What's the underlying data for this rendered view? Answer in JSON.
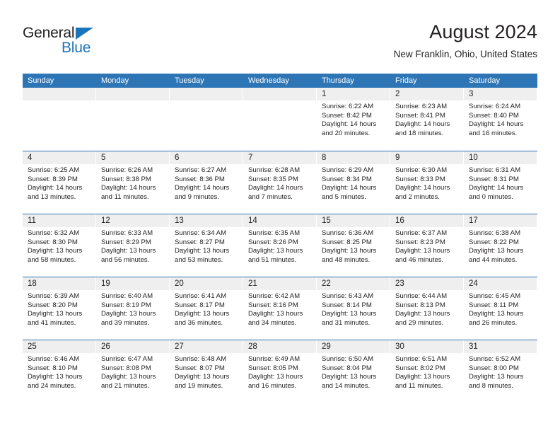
{
  "brand": {
    "name_part1": "General",
    "name_part2": "Blue",
    "accent_color": "#1b75bb",
    "triangle_icon": "blue-triangle-icon"
  },
  "header": {
    "title": "August 2024",
    "subtitle": "New Franklin, Ohio, United States"
  },
  "calendar": {
    "header_bg": "#2e75b6",
    "daynum_bg": "#efefef",
    "weekdays": [
      "Sunday",
      "Monday",
      "Tuesday",
      "Wednesday",
      "Thursday",
      "Friday",
      "Saturday"
    ],
    "weeks": [
      [
        {
          "empty": true
        },
        {
          "empty": true
        },
        {
          "empty": true
        },
        {
          "empty": true
        },
        {
          "day": "1",
          "sunrise": "Sunrise: 6:22 AM",
          "sunset": "Sunset: 8:42 PM",
          "daylight1": "Daylight: 14 hours",
          "daylight2": "and 20 minutes."
        },
        {
          "day": "2",
          "sunrise": "Sunrise: 6:23 AM",
          "sunset": "Sunset: 8:41 PM",
          "daylight1": "Daylight: 14 hours",
          "daylight2": "and 18 minutes."
        },
        {
          "day": "3",
          "sunrise": "Sunrise: 6:24 AM",
          "sunset": "Sunset: 8:40 PM",
          "daylight1": "Daylight: 14 hours",
          "daylight2": "and 16 minutes."
        }
      ],
      [
        {
          "day": "4",
          "sunrise": "Sunrise: 6:25 AM",
          "sunset": "Sunset: 8:39 PM",
          "daylight1": "Daylight: 14 hours",
          "daylight2": "and 13 minutes."
        },
        {
          "day": "5",
          "sunrise": "Sunrise: 6:26 AM",
          "sunset": "Sunset: 8:38 PM",
          "daylight1": "Daylight: 14 hours",
          "daylight2": "and 11 minutes."
        },
        {
          "day": "6",
          "sunrise": "Sunrise: 6:27 AM",
          "sunset": "Sunset: 8:36 PM",
          "daylight1": "Daylight: 14 hours",
          "daylight2": "and 9 minutes."
        },
        {
          "day": "7",
          "sunrise": "Sunrise: 6:28 AM",
          "sunset": "Sunset: 8:35 PM",
          "daylight1": "Daylight: 14 hours",
          "daylight2": "and 7 minutes."
        },
        {
          "day": "8",
          "sunrise": "Sunrise: 6:29 AM",
          "sunset": "Sunset: 8:34 PM",
          "daylight1": "Daylight: 14 hours",
          "daylight2": "and 5 minutes."
        },
        {
          "day": "9",
          "sunrise": "Sunrise: 6:30 AM",
          "sunset": "Sunset: 8:33 PM",
          "daylight1": "Daylight: 14 hours",
          "daylight2": "and 2 minutes."
        },
        {
          "day": "10",
          "sunrise": "Sunrise: 6:31 AM",
          "sunset": "Sunset: 8:31 PM",
          "daylight1": "Daylight: 14 hours",
          "daylight2": "and 0 minutes."
        }
      ],
      [
        {
          "day": "11",
          "sunrise": "Sunrise: 6:32 AM",
          "sunset": "Sunset: 8:30 PM",
          "daylight1": "Daylight: 13 hours",
          "daylight2": "and 58 minutes."
        },
        {
          "day": "12",
          "sunrise": "Sunrise: 6:33 AM",
          "sunset": "Sunset: 8:29 PM",
          "daylight1": "Daylight: 13 hours",
          "daylight2": "and 56 minutes."
        },
        {
          "day": "13",
          "sunrise": "Sunrise: 6:34 AM",
          "sunset": "Sunset: 8:27 PM",
          "daylight1": "Daylight: 13 hours",
          "daylight2": "and 53 minutes."
        },
        {
          "day": "14",
          "sunrise": "Sunrise: 6:35 AM",
          "sunset": "Sunset: 8:26 PM",
          "daylight1": "Daylight: 13 hours",
          "daylight2": "and 51 minutes."
        },
        {
          "day": "15",
          "sunrise": "Sunrise: 6:36 AM",
          "sunset": "Sunset: 8:25 PM",
          "daylight1": "Daylight: 13 hours",
          "daylight2": "and 48 minutes."
        },
        {
          "day": "16",
          "sunrise": "Sunrise: 6:37 AM",
          "sunset": "Sunset: 8:23 PM",
          "daylight1": "Daylight: 13 hours",
          "daylight2": "and 46 minutes."
        },
        {
          "day": "17",
          "sunrise": "Sunrise: 6:38 AM",
          "sunset": "Sunset: 8:22 PM",
          "daylight1": "Daylight: 13 hours",
          "daylight2": "and 44 minutes."
        }
      ],
      [
        {
          "day": "18",
          "sunrise": "Sunrise: 6:39 AM",
          "sunset": "Sunset: 8:20 PM",
          "daylight1": "Daylight: 13 hours",
          "daylight2": "and 41 minutes."
        },
        {
          "day": "19",
          "sunrise": "Sunrise: 6:40 AM",
          "sunset": "Sunset: 8:19 PM",
          "daylight1": "Daylight: 13 hours",
          "daylight2": "and 39 minutes."
        },
        {
          "day": "20",
          "sunrise": "Sunrise: 6:41 AM",
          "sunset": "Sunset: 8:17 PM",
          "daylight1": "Daylight: 13 hours",
          "daylight2": "and 36 minutes."
        },
        {
          "day": "21",
          "sunrise": "Sunrise: 6:42 AM",
          "sunset": "Sunset: 8:16 PM",
          "daylight1": "Daylight: 13 hours",
          "daylight2": "and 34 minutes."
        },
        {
          "day": "22",
          "sunrise": "Sunrise: 6:43 AM",
          "sunset": "Sunset: 8:14 PM",
          "daylight1": "Daylight: 13 hours",
          "daylight2": "and 31 minutes."
        },
        {
          "day": "23",
          "sunrise": "Sunrise: 6:44 AM",
          "sunset": "Sunset: 8:13 PM",
          "daylight1": "Daylight: 13 hours",
          "daylight2": "and 29 minutes."
        },
        {
          "day": "24",
          "sunrise": "Sunrise: 6:45 AM",
          "sunset": "Sunset: 8:11 PM",
          "daylight1": "Daylight: 13 hours",
          "daylight2": "and 26 minutes."
        }
      ],
      [
        {
          "day": "25",
          "sunrise": "Sunrise: 6:46 AM",
          "sunset": "Sunset: 8:10 PM",
          "daylight1": "Daylight: 13 hours",
          "daylight2": "and 24 minutes."
        },
        {
          "day": "26",
          "sunrise": "Sunrise: 6:47 AM",
          "sunset": "Sunset: 8:08 PM",
          "daylight1": "Daylight: 13 hours",
          "daylight2": "and 21 minutes."
        },
        {
          "day": "27",
          "sunrise": "Sunrise: 6:48 AM",
          "sunset": "Sunset: 8:07 PM",
          "daylight1": "Daylight: 13 hours",
          "daylight2": "and 19 minutes."
        },
        {
          "day": "28",
          "sunrise": "Sunrise: 6:49 AM",
          "sunset": "Sunset: 8:05 PM",
          "daylight1": "Daylight: 13 hours",
          "daylight2": "and 16 minutes."
        },
        {
          "day": "29",
          "sunrise": "Sunrise: 6:50 AM",
          "sunset": "Sunset: 8:04 PM",
          "daylight1": "Daylight: 13 hours",
          "daylight2": "and 14 minutes."
        },
        {
          "day": "30",
          "sunrise": "Sunrise: 6:51 AM",
          "sunset": "Sunset: 8:02 PM",
          "daylight1": "Daylight: 13 hours",
          "daylight2": "and 11 minutes."
        },
        {
          "day": "31",
          "sunrise": "Sunrise: 6:52 AM",
          "sunset": "Sunset: 8:00 PM",
          "daylight1": "Daylight: 13 hours",
          "daylight2": "and 8 minutes."
        }
      ]
    ]
  }
}
